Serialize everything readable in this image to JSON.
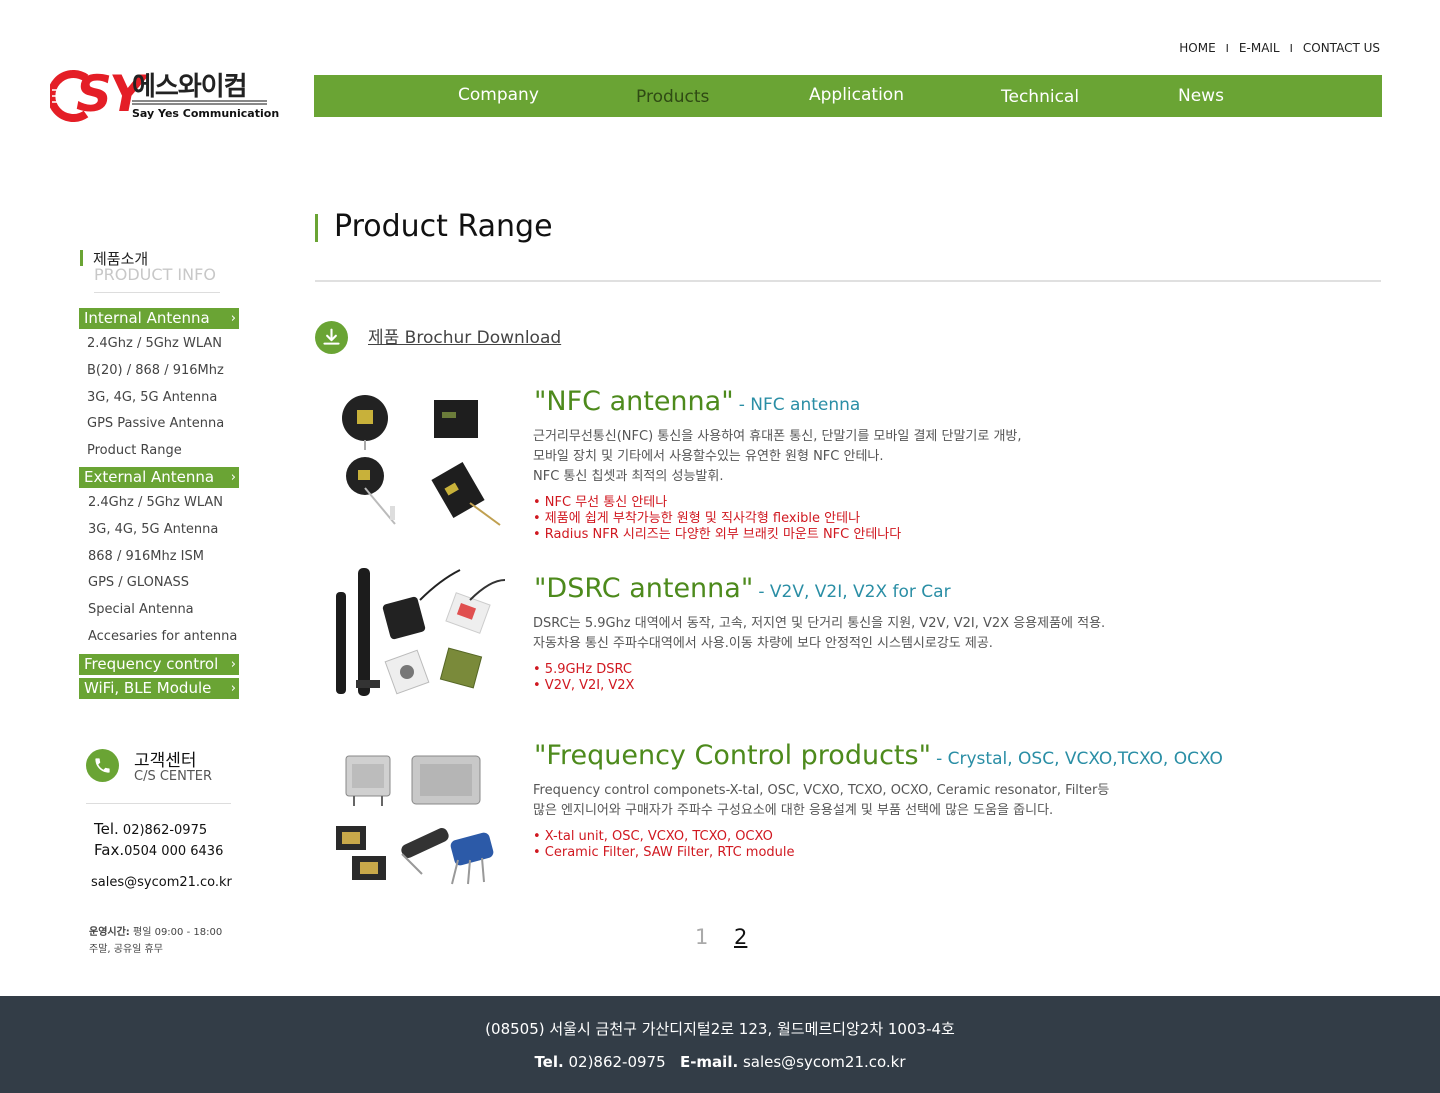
{
  "top_links": [
    "HOME",
    "E-MAIL",
    "CONTACT US"
  ],
  "top_sep": "I",
  "logo": {
    "mark": "SY",
    "kr": "에스와이컴",
    "en": "Say Yes Communication"
  },
  "gnb": [
    "Company",
    "Products",
    "Application",
    "Technical",
    "News"
  ],
  "lnb": {
    "title_kr": "제품소개",
    "title_en": "PRODUCT INFO",
    "arrow": "›",
    "cat_internal": "Internal Antenna",
    "internal_items": [
      "2.4Ghz / 5Ghz WLAN",
      "B(20) / 868 / 916Mhz",
      "3G, 4G, 5G Antenna",
      "GPS Passive Antenna",
      "Product Range"
    ],
    "cat_external": "External Antenna",
    "external_items": [
      "2.4Ghz / 5Ghz WLAN",
      "3G, 4G, 5G Antenna",
      "868 / 916Mhz ISM",
      "GPS / GLONASS",
      "Special Antenna",
      "Accesaries for antenna"
    ],
    "cat_frequency": "Frequency control",
    "cat_wifi": "WiFi, BLE Module"
  },
  "cs": {
    "kr": "고객센터",
    "en": "C/S CENTER",
    "tel_label": "Tel.",
    "tel": "02)862-0975",
    "fax_label": "Fax.",
    "fax": "0504 000 6436",
    "email": "sales@sycom21.co.kr",
    "hours_label": "운영시간:",
    "hours": "평일 09:00 - 18:00",
    "closed": "주말, 공유일 휴무"
  },
  "content": {
    "title": "Product Range",
    "download": "제품 Brochur Download"
  },
  "products": [
    {
      "title": "\"NFC antenna\"",
      "subtitle": "- NFC antenna",
      "desc": [
        "근거리무선통신(NFC) 통신을 사용하여 휴대폰 통신, 단말기를 모바일 결제 단말기로 개방,",
        "모바일 장치 및 기타에서 사용할수있는 유연한 원형 NFC 안테나.",
        "NFC 통신 칩셋과 최적의 성능발휘."
      ],
      "bullets": [
        "• NFC 무선 통신 안테나",
        "• 제품에 쉽게 부착가능한 원형 및 직사각형 flexible 안테나",
        "• Radius NFR 시리즈는 다양한 외부 브래킷 마운트 NFC 안테나다"
      ]
    },
    {
      "title": "\"DSRC antenna\"",
      "subtitle": "- V2V, V2I, V2X for Car",
      "desc": [
        "DSRC는 5.9Ghz 대역에서 동작, 고속, 저지연 및 단거리 통신을 지원, V2V, V2I, V2X 응용제품에 적용.",
        "자동차용 통신 주파수대역에서 사용.이동 차량에 보다 안정적인 시스템시로강도 제공."
      ],
      "bullets": [
        "• 5.9GHz DSRC",
        "• V2V, V2I, V2X"
      ]
    },
    {
      "title": "\"Frequency Control products\"",
      "subtitle": "- Crystal, OSC, VCXO,TCXO, OCXO",
      "desc": [
        "Frequency control componets-X-tal, OSC, VCXO, TCXO, OCXO, Ceramic resonator, Filter등",
        "많은 엔지니어와 구매자가 주파수 구성요소에 대한 응용설계 및 부품 선택에 많은 도움을 줍니다."
      ],
      "bullets": [
        "• X-tal unit, OSC, VCXO, TCXO, OCXO",
        "• Ceramic Filter, SAW Filter, RTC module"
      ]
    }
  ],
  "pagination": [
    "1",
    "2"
  ],
  "footer": {
    "address": "(08505) 서울시 금천구 가산디지털2로 123, 월드메르디앙2차 1003-4호",
    "tel_label": "Tel.",
    "tel": "02)862-0975",
    "email_label": "E-mail.",
    "email": "sales@sycom21.co.kr"
  },
  "colors": {
    "accent": "#6aa434",
    "brand_red": "#e41e26",
    "footer_bg": "#333d47",
    "subtitle": "#2a8ea5",
    "bullet": "#d01820"
  },
  "icons": [
    "phone-icon",
    "download-icon",
    "chevron-right-icon"
  ]
}
